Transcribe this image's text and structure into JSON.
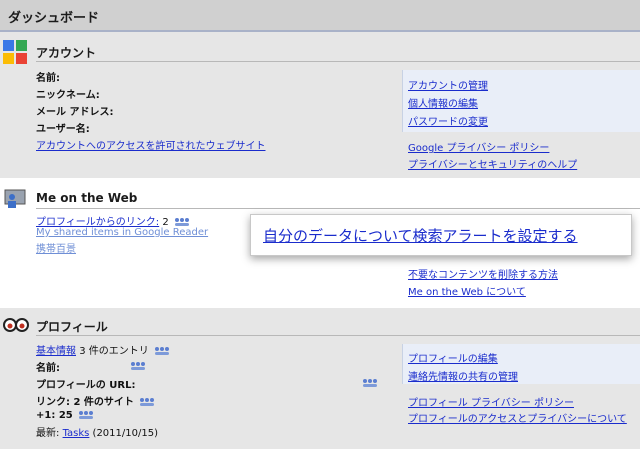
{
  "header": {
    "title": "ダッシュボード"
  },
  "account": {
    "title": "アカウント",
    "fields": [
      "名前:",
      "ニックネーム:",
      "メール アドレス:",
      "ユーザー名:"
    ],
    "access_link": "アカウントへのアクセスを許可されたウェブサイト",
    "links": [
      "アカウントの管理",
      "個人情報の編集",
      "パスワードの変更"
    ],
    "policy_links": [
      "Google プライバシー ポリシー",
      "プライバシーとセキュリティのヘルプ"
    ]
  },
  "web": {
    "title": "Me on the Web",
    "profile_link": "プロフィールからのリンク:",
    "profile_count": "2",
    "reader_link": "My shared items in Google Reader",
    "memo_link": "携帯百景",
    "callout": "自分のデータについて検索アラートを設定する",
    "right_links": [
      "不要なコンテンツを削除する方法",
      "Me on the Web について"
    ]
  },
  "profile": {
    "title": "プロフィール",
    "basic_link": "基本情報",
    "basic_entries": "3 件のエントリ",
    "name_label": "名前:",
    "url_label": "プロフィールの URL:",
    "links_label": "リンク: 2 件のサイト",
    "plus_label": "+1: 25",
    "recent_prefix": "最新:",
    "recent_link": "Tasks",
    "recent_date": "(2011/10/15)",
    "right_links": [
      "プロフィールの編集",
      "連絡先情報の共有の管理"
    ],
    "policy_links": [
      "プロフィール プライバシー ポリシー",
      "プロフィールのアクセスとプライバシーについて"
    ]
  },
  "colors": {
    "link": "#1a2ccc",
    "panel": "#e9eef8"
  }
}
